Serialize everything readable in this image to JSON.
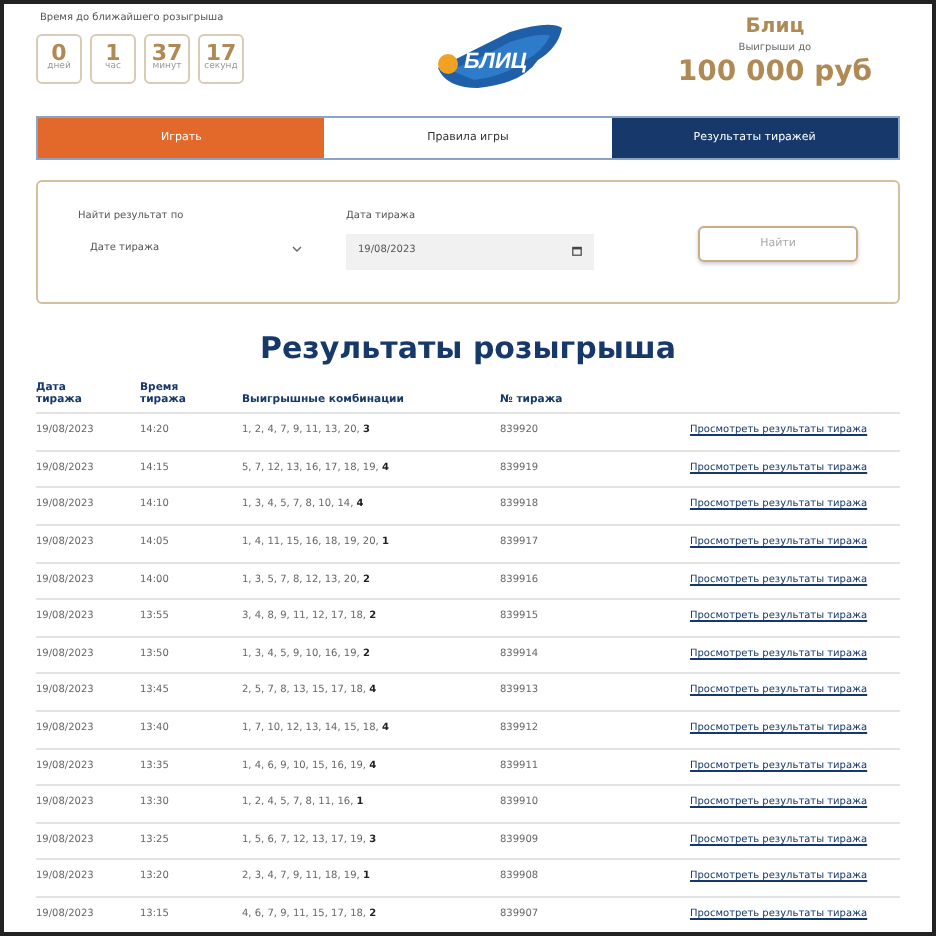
{
  "countdown": {
    "caption": "Время до ближайшего розыгрыша",
    "units": [
      {
        "value": "0",
        "label": "дней"
      },
      {
        "value": "1",
        "label": "час"
      },
      {
        "value": "37",
        "label": "минут"
      },
      {
        "value": "17",
        "label": "секунд"
      }
    ]
  },
  "logo": "БЛИЦ",
  "prize": {
    "name": "Блиц",
    "caption": "Выигрыши до",
    "amount": "100 000 руб"
  },
  "tabs": [
    {
      "label": "Играть",
      "kind": "accent",
      "selected": false
    },
    {
      "label": "Правила игры",
      "kind": "plain",
      "selected": false
    },
    {
      "label": "Результаты тиражей",
      "kind": "plain",
      "selected": true
    }
  ],
  "search": {
    "by_label": "Найти результат по",
    "by_value": "Дате тиража",
    "date_label": "Дата тиража",
    "date_value": "19/08/2023",
    "button": "Найти"
  },
  "title": "Результаты розыгрыша",
  "table": {
    "columns": [
      "Дата тиража",
      "Время тиража",
      "Выигрышные комбинации",
      "№ тиража"
    ],
    "rows": [
      {
        "date": "19/08/2023",
        "time": "14:20",
        "combo": "1, 2, 4, 7, 9, 11, 13, 20, **3**",
        "draw": "839920",
        "link": "Просмотреть результаты тиража"
      },
      {
        "date": "19/08/2023",
        "time": "14:15",
        "combo": "5, 7, 12, 13, 16, 17, 18, 19, **4**",
        "draw": "839919",
        "link": "Просмотреть результаты тиража"
      },
      {
        "date": "19/08/2023",
        "time": "14:10",
        "combo": "1, 3, 4, 5, 7, 8, 10, 14, **4**",
        "draw": "839918",
        "link": "Просмотреть результаты тиража"
      },
      {
        "date": "19/08/2023",
        "time": "14:05",
        "combo": "1, 4, 11, 15, 16, 18, 19, 20, **1**",
        "draw": "839917",
        "link": "Просмотреть результаты тиража"
      },
      {
        "date": "19/08/2023",
        "time": "14:00",
        "combo": "1, 3, 5, 7, 8, 12, 13, 20, **2**",
        "draw": "839916",
        "link": "Просмотреть результаты тиража"
      },
      {
        "date": "19/08/2023",
        "time": "13:55",
        "combo": "3, 4, 8, 9, 11, 12, 17, 18, **2**",
        "draw": "839915",
        "link": "Просмотреть результаты тиража"
      },
      {
        "date": "19/08/2023",
        "time": "13:50",
        "combo": "1, 3, 4, 5, 9, 10, 16, 19, **2**",
        "draw": "839914",
        "link": "Просмотреть результаты тиража"
      },
      {
        "date": "19/08/2023",
        "time": "13:45",
        "combo": "2, 5, 7, 8, 13, 15, 17, 18, **4**",
        "draw": "839913",
        "link": "Просмотреть результаты тиража"
      },
      {
        "date": "19/08/2023",
        "time": "13:40",
        "combo": "1, 7, 10, 12, 13, 14, 15, 18, **4**",
        "draw": "839912",
        "link": "Просмотреть результаты тиража"
      },
      {
        "date": "19/08/2023",
        "time": "13:35",
        "combo": "1, 4, 6, 9, 10, 15, 16, 19, **4**",
        "draw": "839911",
        "link": "Просмотреть результаты тиража"
      },
      {
        "date": "19/08/2023",
        "time": "13:30",
        "combo": "1, 2, 4, 5, 7, 8, 11, 16, **1**",
        "draw": "839910",
        "link": "Просмотреть результаты тиража"
      },
      {
        "date": "19/08/2023",
        "time": "13:25",
        "combo": "1, 5, 6, 7, 12, 13, 17, 19, **3**",
        "draw": "839909",
        "link": "Просмотреть результаты тиража"
      },
      {
        "date": "19/08/2023",
        "time": "13:20",
        "combo": "2, 3, 4, 7, 9, 11, 18, 19, **1**",
        "draw": "839908",
        "link": "Просмотреть результаты тиража"
      },
      {
        "date": "19/08/2023",
        "time": "13:15",
        "combo": "4, 6, 7, 9, 11, 15, 17, 18, **2**",
        "draw": "839907",
        "link": "Просмотреть результаты тиража"
      }
    ]
  }
}
